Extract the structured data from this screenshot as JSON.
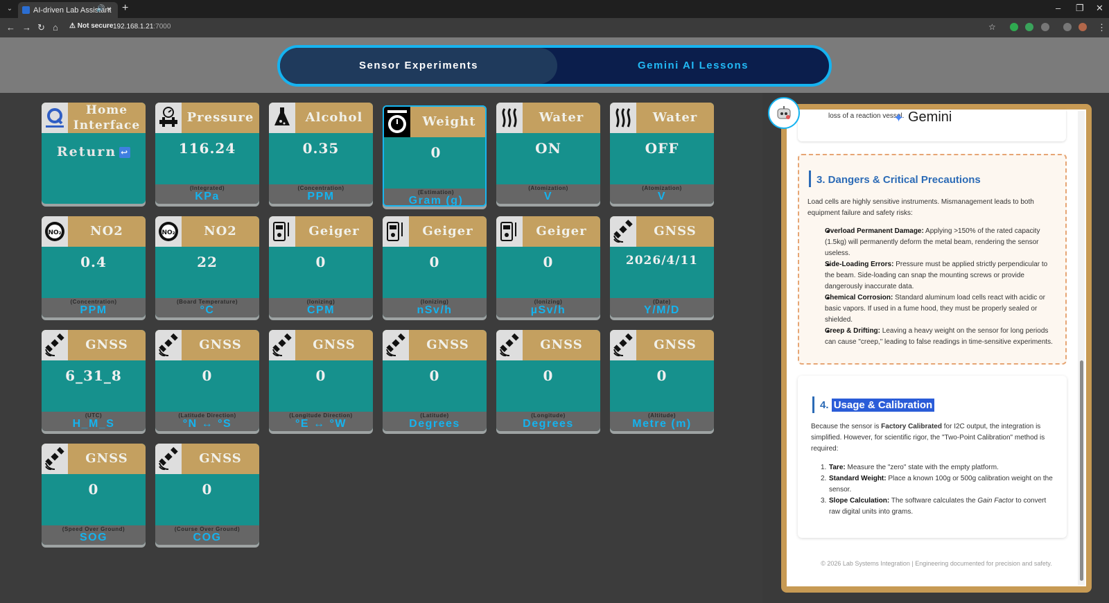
{
  "browser": {
    "tab_title": "AI-driven Lab Assistant",
    "not_secure": "Not secure",
    "url_host": "192.168.1.21",
    "url_port": ":7000"
  },
  "header": {
    "tab1": "Sensor Experiments",
    "tab2": "Gemini AI Lessons"
  },
  "home": {
    "title_line1": "Home",
    "title_line2": "Interface",
    "return_label": "Return"
  },
  "cards": [
    {
      "title": "Pressure",
      "value": "116.24",
      "sub": "(Integrated)",
      "unit": "KPa"
    },
    {
      "title": "Alcohol",
      "value": "0.35",
      "sub": "(Concentration)",
      "unit": "PPM"
    },
    {
      "title": "Weight",
      "value": "0",
      "sub": "(Estimation)",
      "unit": "Gram (g)"
    },
    {
      "title": "Water",
      "value": "ON",
      "sub": "(Atomization)",
      "unit": "V"
    },
    {
      "title": "Water",
      "value": "OFF",
      "sub": "(Atomization)",
      "unit": "V"
    },
    {
      "title": "NO2",
      "value": "0.4",
      "sub": "(Concentration)",
      "unit": "PPM"
    },
    {
      "title": "NO2",
      "value": "22",
      "sub": "(Board Temperature)",
      "unit": "°C"
    },
    {
      "title": "Geiger",
      "value": "0",
      "sub": "(Ionizing)",
      "unit": "CPM"
    },
    {
      "title": "Geiger",
      "value": "0",
      "sub": "(Ionizing)",
      "unit": "nSv/h"
    },
    {
      "title": "Geiger",
      "value": "0",
      "sub": "(Ionizing)",
      "unit": "µSv/h"
    },
    {
      "title": "GNSS",
      "value": "2026/4/11",
      "sub": "(Date)",
      "unit": "Y/M/D"
    },
    {
      "title": "GNSS",
      "value": "6_31_8",
      "sub": "(UTC)",
      "unit": "H_M_S"
    },
    {
      "title": "GNSS",
      "value": "0",
      "sub": "(Latitude Direction)",
      "unit": "°N ↔ °S"
    },
    {
      "title": "GNSS",
      "value": "0",
      "sub": "(Longitude Direction)",
      "unit": "°E ↔ °W"
    },
    {
      "title": "GNSS",
      "value": "0",
      "sub": "(Latitude)",
      "unit": "Degrees"
    },
    {
      "title": "GNSS",
      "value": "0",
      "sub": "(Longitude)",
      "unit": "Degrees"
    },
    {
      "title": "GNSS",
      "value": "0",
      "sub": "(Altitude)",
      "unit": "Metre (m)"
    },
    {
      "title": "GNSS",
      "value": "0",
      "sub": "(Speed Over Ground)",
      "unit": "SOG"
    },
    {
      "title": "GNSS",
      "value": "0",
      "sub": "(Course Over Ground)",
      "unit": "COG"
    }
  ],
  "lesson": {
    "gemini_caption": "loss of a reaction vessel.",
    "gemini_logo": "Gemini",
    "sec3_title": "3. Dangers & Critical Precautions",
    "sec3_intro": "Load cells are highly sensitive instruments. Mismanagement leads to both equipment failure and safety risks:",
    "sec3_items": [
      {
        "bold": "Overload Permanent Damage:",
        "text": " Applying >150% of the rated capacity (1.5kg) will permanently deform the metal beam, rendering the sensor useless."
      },
      {
        "bold": "Side-Loading Errors:",
        "text": " Pressure must be applied strictly perpendicular to the beam. Side-loading can snap the mounting screws or provide dangerously inaccurate data."
      },
      {
        "bold": "Chemical Corrosion:",
        "text": " Standard aluminum load cells react with acidic or basic vapors. If used in a fume hood, they must be properly sealed or shielded."
      },
      {
        "bold": "Creep & Drifting:",
        "text": " Leaving a heavy weight on the sensor for long periods can cause \"creep,\" leading to false readings in time-sensitive experiments."
      }
    ],
    "sec4_num": "4.",
    "sec4_title": "Usage & Calibration",
    "sec4_intro_a": "Because the sensor is ",
    "sec4_intro_b": "Factory Calibrated",
    "sec4_intro_c": " for I2C output, the integration is simplified. However, for scientific rigor, the \"Two-Point Calibration\" method is required:",
    "sec4_items": [
      {
        "num": "1.",
        "bold": "Tare:",
        "text": " Measure the \"zero\" state with the empty platform."
      },
      {
        "num": "2.",
        "bold": "Standard Weight:",
        "text": " Place a known 100g or 500g calibration weight on the sensor."
      },
      {
        "num": "3.",
        "bold": "Slope Calculation:",
        "text": " The software calculates the ",
        "italic": "Gain Factor",
        "text2": " to convert raw digital units into grams."
      }
    ],
    "footer": "© 2026 Lab Systems Integration | Engineering documented for precision and safety."
  }
}
